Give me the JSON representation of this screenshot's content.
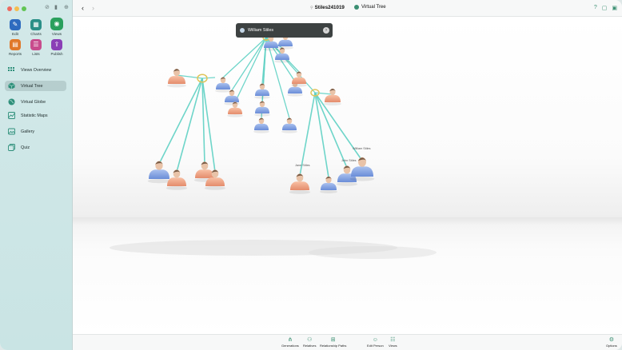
{
  "window": {
    "traffic_colors": [
      "#ee6a5f",
      "#f5bd4f",
      "#61c554"
    ]
  },
  "sidebar": {
    "tools": [
      {
        "name": "edit",
        "label": "Edit",
        "color": "#2e6bbf",
        "glyph": "✎"
      },
      {
        "name": "charts",
        "label": "Charts",
        "color": "#2a8f87",
        "glyph": "▦"
      },
      {
        "name": "views",
        "label": "Views",
        "color": "#2aa05d",
        "glyph": "◉"
      },
      {
        "name": "reports",
        "label": "Reports",
        "color": "#e0782a",
        "glyph": "▤"
      },
      {
        "name": "lists",
        "label": "Lists",
        "color": "#c84b8d",
        "glyph": "☰"
      },
      {
        "name": "publish",
        "label": "Publish",
        "color": "#8a3fb6",
        "glyph": "⇪"
      }
    ],
    "nav": [
      {
        "name": "views-overview",
        "label": "Views Overview",
        "icon": "grid-icon"
      },
      {
        "name": "virtual-tree",
        "label": "Virtual Tree",
        "icon": "cube-icon"
      },
      {
        "name": "virtual-globe",
        "label": "Virtual Globe",
        "icon": "globe-icon"
      },
      {
        "name": "statistic-maps",
        "label": "Statistic Maps",
        "icon": "map-icon"
      },
      {
        "name": "gallery",
        "label": "Gallery",
        "icon": "gallery-icon"
      },
      {
        "name": "quiz",
        "label": "Quiz",
        "icon": "quiz-icon"
      }
    ],
    "selected_nav": "Virtual Tree"
  },
  "titlebar": {
    "document_title": "Stiles241019",
    "view_title": "Virtual Tree",
    "accent": "#3b8f72"
  },
  "tree": {
    "popover_name": "William Stiles",
    "floating_labels": [
      "William Stiles",
      "John Stiles",
      "Jane Stiles"
    ],
    "male_color": "#7e9fe0",
    "female_color": "#f0a27e",
    "line_color": "#5fd1c4"
  },
  "bottombar": {
    "buttons": [
      {
        "name": "generations",
        "label": "Generations",
        "glyph": "⋔"
      },
      {
        "name": "relatives",
        "label": "Relatives",
        "glyph": "⚇"
      },
      {
        "name": "relationship-paths",
        "label": "Relationship Paths",
        "glyph": "⊞"
      },
      {
        "name": "edit-person",
        "label": "Edit Person",
        "glyph": "☺"
      },
      {
        "name": "views",
        "label": "Views",
        "glyph": "☷"
      },
      {
        "name": "options",
        "label": "Options",
        "glyph": "⚙"
      }
    ]
  }
}
